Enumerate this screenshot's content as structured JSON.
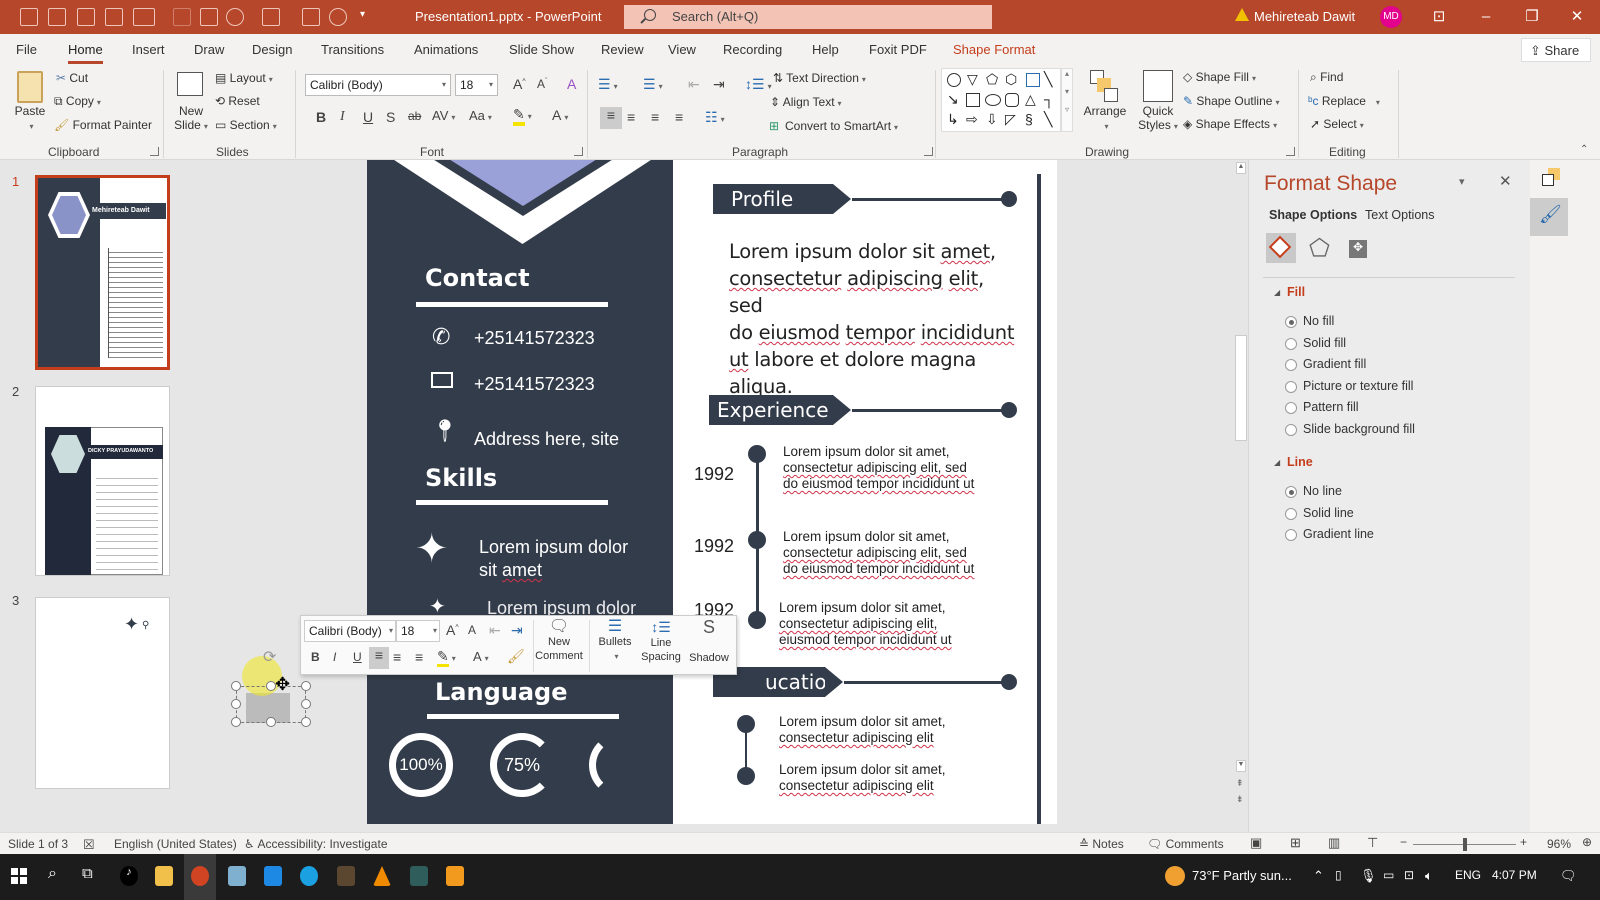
{
  "window": {
    "title": "Presentation1.pptx  -  PowerPoint",
    "search_placeholder": "Search (Alt+Q)",
    "user_name": "Mehireteab Dawit",
    "user_initials": "MD",
    "accent": "#b7472a"
  },
  "tabs": [
    "File",
    "Home",
    "Insert",
    "Draw",
    "Design",
    "Transitions",
    "Animations",
    "Slide Show",
    "Review",
    "View",
    "Recording",
    "Help",
    "Foxit PDF",
    "Shape Format"
  ],
  "active_tab": "Home",
  "share_label": "Share",
  "ribbon": {
    "clipboard": {
      "paste": "Paste",
      "cut": "Cut",
      "copy": "Copy",
      "format_painter": "Format Painter",
      "label": "Clipboard"
    },
    "slides": {
      "new_slide_1": "New",
      "new_slide_2": "Slide",
      "layout": "Layout",
      "reset": "Reset",
      "section": "Section",
      "label": "Slides"
    },
    "font": {
      "name": "Calibri (Body)",
      "size": "18",
      "bold": "B",
      "italic": "I",
      "underline": "U",
      "shadow": "S",
      "strike": "ab",
      "spacing": "AV",
      "case": "Aa",
      "color": "A",
      "label": "Font"
    },
    "paragraph": {
      "text_direction": "Text Direction",
      "align_text": "Align Text",
      "convert_smartart": "Convert to SmartArt",
      "label": "Paragraph"
    },
    "drawing": {
      "arrange": "Arrange",
      "quick_1": "Quick",
      "quick_2": "Styles",
      "shape_fill": "Shape Fill",
      "shape_outline": "Shape Outline",
      "shape_effects": "Shape Effects",
      "label": "Drawing"
    },
    "editing": {
      "find": "Find",
      "replace": "Replace",
      "select": "Select",
      "label": "Editing"
    }
  },
  "thumbnails": [
    {
      "num": "1",
      "title": "Mehireteab Dawit",
      "active": true
    },
    {
      "num": "2",
      "title": "DICKY PRAYUDAWANTO",
      "active": false
    },
    {
      "num": "3",
      "title": "",
      "active": false
    }
  ],
  "slide": {
    "contact_heading": "Contact",
    "phone": "+25141572323",
    "email": "+25141572323",
    "address": "Address here, site",
    "skills_heading": "Skills",
    "skill1_line1": "Lorem ipsum dolor",
    "skill1_line2a": "sit ",
    "skill1_line2b": "amet",
    "skill2": "Lorem ipsum dolor",
    "language_heading": "Language",
    "lang_values": [
      "100%",
      "75%",
      ""
    ],
    "profile_heading": "Profile",
    "profile_text": {
      "l1a": "Lorem ipsum dolor sit ",
      "l1b": "amet",
      ",": ",",
      "l2a": "consectetur",
      "l2b": " ",
      "l2c": "adipiscing",
      "l2d": " ",
      "l2e": "elit",
      ", sed": ", sed",
      "l3a": "do ",
      "l3b": "eiusmod",
      "l3c": " ",
      "l3d": "tempor",
      "l3e": " ",
      "l3f": "incididunt",
      "l4a": "ut",
      "l4b": " labore et dolore magna",
      "l5": "aliqua",
      "l5end": "."
    },
    "experience_heading": "Experience",
    "experience": [
      {
        "year": "1992",
        "l1": "Lorem ipsum dolor sit amet,",
        "l2": "consectetur adipiscing elit, sed",
        "l3": "do eiusmod tempor incididunt ut"
      },
      {
        "year": "1992",
        "l1": "Lorem ipsum dolor sit amet,",
        "l2": "consectetur adipiscing elit, sed",
        "l3": "do eiusmod tempor incididunt ut"
      },
      {
        "year": "1992",
        "l1": "Lorem ipsum dolor sit amet,",
        "l2": "consectetur adipiscing elit,",
        "l3": "eiusmod tempor incididunt ut"
      }
    ],
    "education_heading": "Education",
    "education_visible": "ucation",
    "education": [
      {
        "l1": "Lorem ipsum dolor sit amet,",
        "l2": "consectetur adipiscing elit"
      },
      {
        "l1": "Lorem ipsum dolor sit amet,",
        "l2": "consectetur adipiscing elit"
      }
    ]
  },
  "mini_toolbar": {
    "font": "Calibri (Body)",
    "size": "18",
    "bold": "B",
    "italic": "I",
    "underline": "U",
    "new_comment_1": "New",
    "new_comment_2": "Comment",
    "bullets": "Bullets",
    "line_1": "Line",
    "line_2": "Spacing",
    "shadow": "Shadow"
  },
  "format_pane": {
    "title": "Format Shape",
    "tab_shape": "Shape Options",
    "tab_text": "Text Options",
    "fill_heading": "Fill",
    "fill_options": [
      "No fill",
      "Solid fill",
      "Gradient fill",
      "Picture or texture fill",
      "Pattern fill",
      "Slide background fill"
    ],
    "fill_selected": "No fill",
    "line_heading": "Line",
    "line_options": [
      "No line",
      "Solid line",
      "Gradient line"
    ],
    "line_selected": "No line"
  },
  "status": {
    "slide_info": "Slide 1 of 3",
    "language": "English (United States)",
    "accessibility": "Accessibility: Investigate",
    "notes": "Notes",
    "comments": "Comments",
    "zoom": "96%",
    "zoom_fraction": 0.5
  },
  "taskbar": {
    "weather": "73°F  Partly sun...",
    "lang": "ENG",
    "time": "4:07 PM"
  }
}
